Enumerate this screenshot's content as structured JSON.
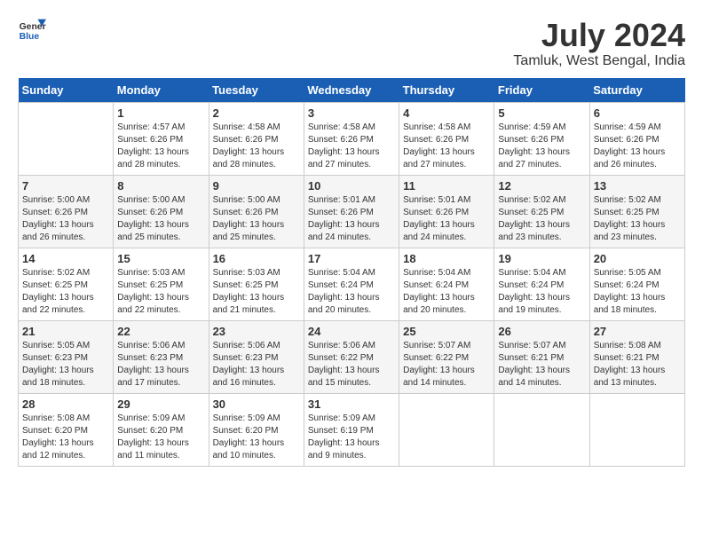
{
  "header": {
    "logo_line1": "General",
    "logo_line2": "Blue",
    "title": "July 2024",
    "subtitle": "Tamluk, West Bengal, India"
  },
  "days_of_week": [
    "Sunday",
    "Monday",
    "Tuesday",
    "Wednesday",
    "Thursday",
    "Friday",
    "Saturday"
  ],
  "weeks": [
    [
      {
        "num": "",
        "sunrise": "",
        "sunset": "",
        "daylight": ""
      },
      {
        "num": "1",
        "sunrise": "Sunrise: 4:57 AM",
        "sunset": "Sunset: 6:26 PM",
        "daylight": "Daylight: 13 hours and 28 minutes."
      },
      {
        "num": "2",
        "sunrise": "Sunrise: 4:58 AM",
        "sunset": "Sunset: 6:26 PM",
        "daylight": "Daylight: 13 hours and 28 minutes."
      },
      {
        "num": "3",
        "sunrise": "Sunrise: 4:58 AM",
        "sunset": "Sunset: 6:26 PM",
        "daylight": "Daylight: 13 hours and 27 minutes."
      },
      {
        "num": "4",
        "sunrise": "Sunrise: 4:58 AM",
        "sunset": "Sunset: 6:26 PM",
        "daylight": "Daylight: 13 hours and 27 minutes."
      },
      {
        "num": "5",
        "sunrise": "Sunrise: 4:59 AM",
        "sunset": "Sunset: 6:26 PM",
        "daylight": "Daylight: 13 hours and 27 minutes."
      },
      {
        "num": "6",
        "sunrise": "Sunrise: 4:59 AM",
        "sunset": "Sunset: 6:26 PM",
        "daylight": "Daylight: 13 hours and 26 minutes."
      }
    ],
    [
      {
        "num": "7",
        "sunrise": "Sunrise: 5:00 AM",
        "sunset": "Sunset: 6:26 PM",
        "daylight": "Daylight: 13 hours and 26 minutes."
      },
      {
        "num": "8",
        "sunrise": "Sunrise: 5:00 AM",
        "sunset": "Sunset: 6:26 PM",
        "daylight": "Daylight: 13 hours and 25 minutes."
      },
      {
        "num": "9",
        "sunrise": "Sunrise: 5:00 AM",
        "sunset": "Sunset: 6:26 PM",
        "daylight": "Daylight: 13 hours and 25 minutes."
      },
      {
        "num": "10",
        "sunrise": "Sunrise: 5:01 AM",
        "sunset": "Sunset: 6:26 PM",
        "daylight": "Daylight: 13 hours and 24 minutes."
      },
      {
        "num": "11",
        "sunrise": "Sunrise: 5:01 AM",
        "sunset": "Sunset: 6:26 PM",
        "daylight": "Daylight: 13 hours and 24 minutes."
      },
      {
        "num": "12",
        "sunrise": "Sunrise: 5:02 AM",
        "sunset": "Sunset: 6:25 PM",
        "daylight": "Daylight: 13 hours and 23 minutes."
      },
      {
        "num": "13",
        "sunrise": "Sunrise: 5:02 AM",
        "sunset": "Sunset: 6:25 PM",
        "daylight": "Daylight: 13 hours and 23 minutes."
      }
    ],
    [
      {
        "num": "14",
        "sunrise": "Sunrise: 5:02 AM",
        "sunset": "Sunset: 6:25 PM",
        "daylight": "Daylight: 13 hours and 22 minutes."
      },
      {
        "num": "15",
        "sunrise": "Sunrise: 5:03 AM",
        "sunset": "Sunset: 6:25 PM",
        "daylight": "Daylight: 13 hours and 22 minutes."
      },
      {
        "num": "16",
        "sunrise": "Sunrise: 5:03 AM",
        "sunset": "Sunset: 6:25 PM",
        "daylight": "Daylight: 13 hours and 21 minutes."
      },
      {
        "num": "17",
        "sunrise": "Sunrise: 5:04 AM",
        "sunset": "Sunset: 6:24 PM",
        "daylight": "Daylight: 13 hours and 20 minutes."
      },
      {
        "num": "18",
        "sunrise": "Sunrise: 5:04 AM",
        "sunset": "Sunset: 6:24 PM",
        "daylight": "Daylight: 13 hours and 20 minutes."
      },
      {
        "num": "19",
        "sunrise": "Sunrise: 5:04 AM",
        "sunset": "Sunset: 6:24 PM",
        "daylight": "Daylight: 13 hours and 19 minutes."
      },
      {
        "num": "20",
        "sunrise": "Sunrise: 5:05 AM",
        "sunset": "Sunset: 6:24 PM",
        "daylight": "Daylight: 13 hours and 18 minutes."
      }
    ],
    [
      {
        "num": "21",
        "sunrise": "Sunrise: 5:05 AM",
        "sunset": "Sunset: 6:23 PM",
        "daylight": "Daylight: 13 hours and 18 minutes."
      },
      {
        "num": "22",
        "sunrise": "Sunrise: 5:06 AM",
        "sunset": "Sunset: 6:23 PM",
        "daylight": "Daylight: 13 hours and 17 minutes."
      },
      {
        "num": "23",
        "sunrise": "Sunrise: 5:06 AM",
        "sunset": "Sunset: 6:23 PM",
        "daylight": "Daylight: 13 hours and 16 minutes."
      },
      {
        "num": "24",
        "sunrise": "Sunrise: 5:06 AM",
        "sunset": "Sunset: 6:22 PM",
        "daylight": "Daylight: 13 hours and 15 minutes."
      },
      {
        "num": "25",
        "sunrise": "Sunrise: 5:07 AM",
        "sunset": "Sunset: 6:22 PM",
        "daylight": "Daylight: 13 hours and 14 minutes."
      },
      {
        "num": "26",
        "sunrise": "Sunrise: 5:07 AM",
        "sunset": "Sunset: 6:21 PM",
        "daylight": "Daylight: 13 hours and 14 minutes."
      },
      {
        "num": "27",
        "sunrise": "Sunrise: 5:08 AM",
        "sunset": "Sunset: 6:21 PM",
        "daylight": "Daylight: 13 hours and 13 minutes."
      }
    ],
    [
      {
        "num": "28",
        "sunrise": "Sunrise: 5:08 AM",
        "sunset": "Sunset: 6:20 PM",
        "daylight": "Daylight: 13 hours and 12 minutes."
      },
      {
        "num": "29",
        "sunrise": "Sunrise: 5:09 AM",
        "sunset": "Sunset: 6:20 PM",
        "daylight": "Daylight: 13 hours and 11 minutes."
      },
      {
        "num": "30",
        "sunrise": "Sunrise: 5:09 AM",
        "sunset": "Sunset: 6:20 PM",
        "daylight": "Daylight: 13 hours and 10 minutes."
      },
      {
        "num": "31",
        "sunrise": "Sunrise: 5:09 AM",
        "sunset": "Sunset: 6:19 PM",
        "daylight": "Daylight: 13 hours and 9 minutes."
      },
      {
        "num": "",
        "sunrise": "",
        "sunset": "",
        "daylight": ""
      },
      {
        "num": "",
        "sunrise": "",
        "sunset": "",
        "daylight": ""
      },
      {
        "num": "",
        "sunrise": "",
        "sunset": "",
        "daylight": ""
      }
    ]
  ]
}
